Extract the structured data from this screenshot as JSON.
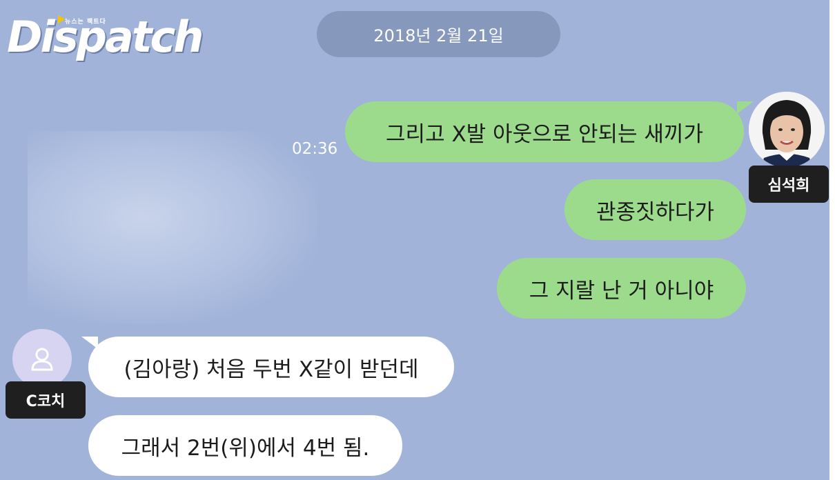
{
  "logo": {
    "text": "Dispatch",
    "tagline": "뉴스는 팩트다"
  },
  "chat": {
    "date": "2018년 2월 21일",
    "right_sender": {
      "name": "심석희"
    },
    "left_sender": {
      "name": "C코치"
    },
    "right_messages": [
      {
        "text": "그리고 X발 아웃으로 안되는 새끼가",
        "time": "02:36"
      },
      {
        "text": "관종짓하다가"
      },
      {
        "text": "그 지랄 난 거 아니야"
      }
    ],
    "left_messages": [
      {
        "text": "(김아랑) 처음 두번 X같이 받던데"
      },
      {
        "text": "그래서 2번(위)에서 4번 됨."
      }
    ]
  },
  "colors": {
    "background": "#a1b3d9",
    "my_bubble": "#9ddb8c",
    "other_bubble": "#ffffff",
    "date_pill": "#8798bd",
    "name_tag": "#1f1f1f"
  }
}
